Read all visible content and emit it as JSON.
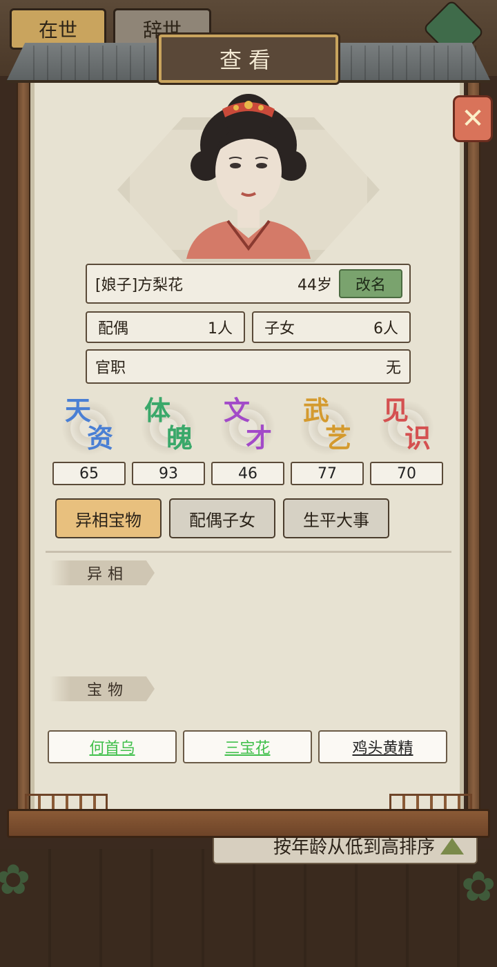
{
  "background": {
    "tabs": [
      "在世",
      "辞世"
    ],
    "sort_label": "按年龄从低到高排序"
  },
  "dialog": {
    "title": "查看",
    "close_icon": "close-x-icon"
  },
  "character": {
    "name": "[娘子]方梨花",
    "age": "44岁",
    "rename_label": "改名",
    "spouse_label": "配偶",
    "spouse_value": "1人",
    "children_label": "子女",
    "children_value": "6人",
    "office_label": "官职",
    "office_value": "无"
  },
  "stats": [
    {
      "c1": "天",
      "c2": "资",
      "value": "65",
      "color": "#4a7fd4"
    },
    {
      "c1": "体",
      "c2": "魄",
      "value": "93",
      "color": "#3aa86a"
    },
    {
      "c1": "文",
      "c2": "才",
      "value": "46",
      "color": "#a24ac8"
    },
    {
      "c1": "武",
      "c2": "艺",
      "value": "77",
      "color": "#d49a2e"
    },
    {
      "c1": "见",
      "c2": "识",
      "value": "70",
      "color": "#d45050"
    }
  ],
  "tabs": [
    {
      "label": "异相宝物",
      "active": true
    },
    {
      "label": "配偶子女",
      "active": false
    },
    {
      "label": "生平大事",
      "active": false
    }
  ],
  "sections": {
    "traits_label": "异相",
    "treasures_label": "宝物"
  },
  "treasures": [
    {
      "name": "何首乌",
      "color": "#3fbf4a"
    },
    {
      "name": "三宝花",
      "color": "#3fbf4a"
    },
    {
      "name": "鸡头黄精",
      "color": "#222222"
    }
  ]
}
